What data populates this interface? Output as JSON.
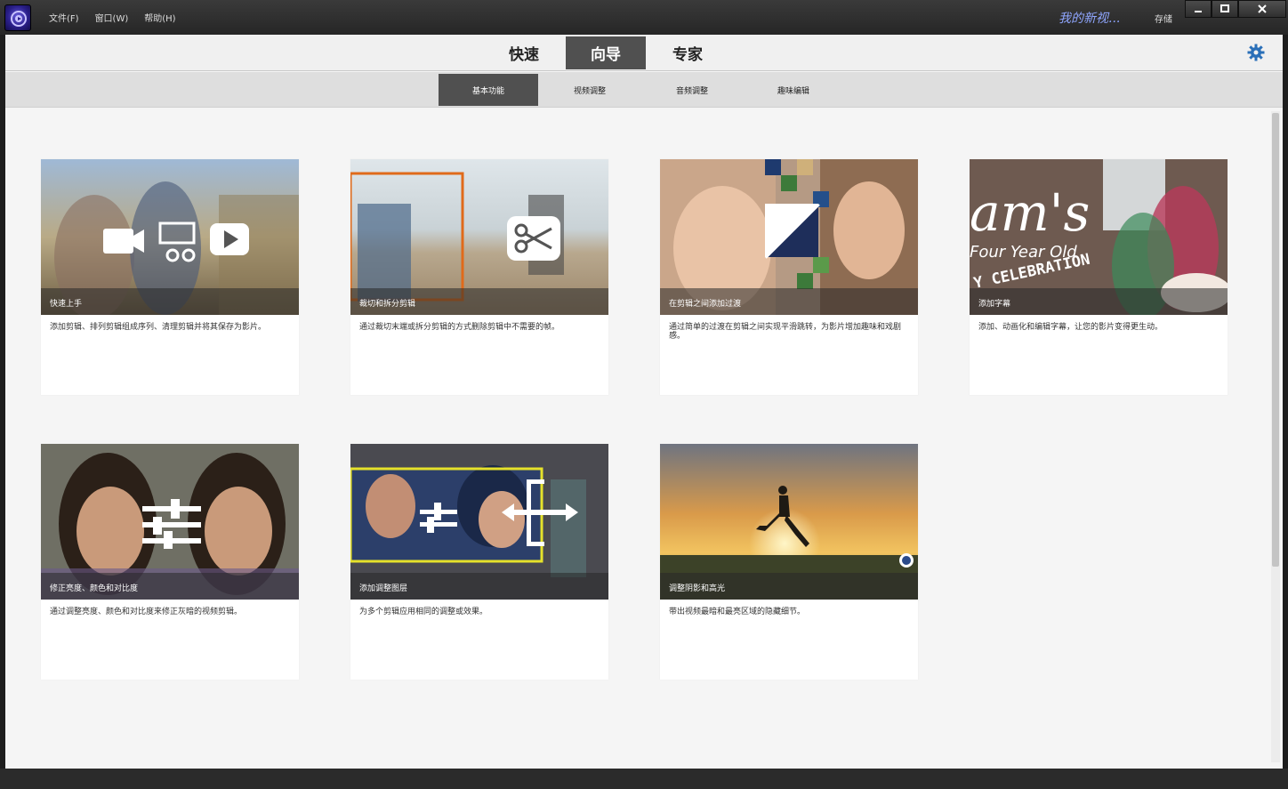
{
  "titlebar": {
    "menu": [
      "文件(F)",
      "窗口(W)",
      "帮助(H)"
    ],
    "project_name": "我的新视...",
    "save_label": "存储"
  },
  "modes": [
    {
      "label": "快速",
      "active": false
    },
    {
      "label": "向导",
      "active": true
    },
    {
      "label": "专家",
      "active": false
    }
  ],
  "subtabs": [
    {
      "label": "基本功能",
      "active": true
    },
    {
      "label": "视频调整",
      "active": false
    },
    {
      "label": "音频调整",
      "active": false
    },
    {
      "label": "趣味编辑",
      "active": false
    }
  ],
  "cards": [
    {
      "title": "快速上手",
      "desc": "添加剪辑、排列剪辑组成序列、清理剪辑并将其保存为影片。",
      "icon": "video-scissors-play-icon"
    },
    {
      "title": "裁切和拆分剪辑",
      "desc": "通过裁切末端或拆分剪辑的方式删除剪辑中不需要的帧。",
      "icon": "scissors-icon"
    },
    {
      "title": "在剪辑之间添加过渡",
      "desc": "通过简单的过渡在剪辑之间实现平滑跳转，为影片增加趣味和戏剧感。",
      "icon": "transition-icon"
    },
    {
      "title": "添加字幕",
      "desc": "添加、动画化和编辑字幕，让您的影片变得更生动。",
      "icon": "title-text-icon"
    },
    {
      "title": "修正亮度、颜色和对比度",
      "desc": "通过调整亮度、颜色和对比度来修正灰暗的视频剪辑。",
      "icon": "adjust-sliders-icon"
    },
    {
      "title": "添加调整图层",
      "desc": "为多个剪辑应用相同的调整或效果。",
      "icon": "adjustment-layer-icon"
    },
    {
      "title": "调整阴影和高光",
      "desc": "带出视频最暗和最亮区域的隐藏细节。",
      "icon": "shadow-highlight-icon"
    }
  ],
  "colors": {
    "accent": "#505050",
    "gear": "#2a6fb8",
    "project_name": "#8fa6ff"
  }
}
